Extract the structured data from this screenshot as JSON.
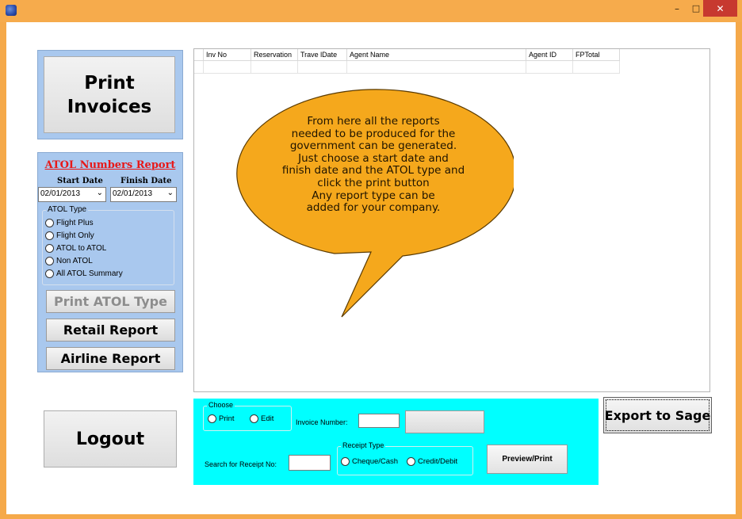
{
  "window": {
    "minimize_glyph": "–",
    "maximize_glyph": "□",
    "close_glyph": "✕"
  },
  "left": {
    "print_invoices_line1": "Print",
    "print_invoices_line2": "Invoices",
    "atol": {
      "title": "ATOL Numbers Report",
      "start_date_label": "Start Date",
      "finish_date_label": "Finish Date",
      "start_date_value": "02/01/2013",
      "finish_date_value": "02/01/2013",
      "type_group_label": "ATOL Type",
      "types": [
        "Flight Plus",
        "Flight Only",
        "ATOL to ATOL",
        "Non ATOL",
        "All ATOL Summary"
      ]
    },
    "print_atol_type": "Print ATOL Type",
    "retail_report": "Retail Report",
    "airline_report": "Airline Report",
    "logout": "Logout"
  },
  "grid": {
    "columns": [
      "Inv No",
      "Reservation",
      "Trave lDate",
      "Agent Name",
      "Agent ID",
      "FPTotal"
    ]
  },
  "bubble": {
    "lines": [
      "From here all the reports",
      "needed to be produced for the",
      "government can be generated.",
      "Just choose a start date and",
      "finish date and the ATOL type and",
      "click the print button",
      "Any report type can be",
      "added for your company."
    ],
    "fill": "#f5a81c",
    "stroke": "#5a3a00"
  },
  "bottom": {
    "choose_label": "Choose",
    "print_option": "Print",
    "edit_option": "Edit",
    "invoice_number_label": "Invoice Number:",
    "invoice_number_value": "",
    "receipt_type_label": "Receipt Type",
    "cheque_cash_option": "Cheque/Cash",
    "credit_debit_option": "Credit/Debit",
    "search_receipt_label": "Search for Receipt No:",
    "search_receipt_value": "",
    "preview_print": "Preview/Print",
    "export_to_sage": "Export to Sage",
    "panel_color": "#00ffff"
  }
}
